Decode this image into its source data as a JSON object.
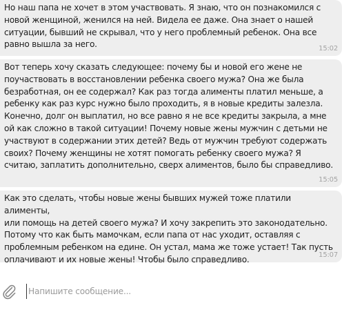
{
  "messages": [
    {
      "text": "Но наш папа не хочет в этом участвовать. Я знаю, что он познакомился с\nновой женщиной, женился на ней. Видела ее даже. Она знает о нашей\nситуации, бывший не скрывал, что у него проблемный ребенок. Она все\nравно вышла за него.",
      "time": "15:02"
    },
    {
      "text": "Вот теперь хочу сказать следующее: почему бы и новой его жене не\nпоучаствовать в восстановлении ребенка своего мужа? Она же была\nбезработная, он ее содержал? Как раз тогда алименты платил меньше, а\nребенку как раз курс нужно было проходить, я в новые кредиты залезла.\nКонечно, долг он выплатил, но все равно я не все кредиты закрыла, а мне\nой как сложно в такой ситуации! Почему новые жены мужчин с детьми не\nучаствуют в содержании этих детей? Ведь от мужчин требуют содержать\nсвоих? Почему женщины не хотят помогать ребенку своего мужа? Я\nсчитаю, заплатить дополнительно, сверх алиментов, было бы справедливо.",
      "time": "15:05"
    },
    {
      "text": "Как это сделать, чтобы новые жены бывших мужей тоже платили алименты,\nили помощь на детей своего мужа? И хочу закрепить это законодательно.\nПотому что как быть мамочкам, если папа от нас уходит, оставляя с\nпроблемным ребенком на едине. Он устал, мама же тоже устает! Так пусть\nоплачивают и их новые жены! Чтобы было справедливо.",
      "time": "15:07"
    }
  ],
  "composer": {
    "placeholder": "Напишите сообщение...",
    "value": "",
    "attach_icon": "paperclip-icon"
  },
  "colors": {
    "bubble_bg": "#eeeeee",
    "text": "#1e1e1e",
    "time": "#a3a3a3",
    "placeholder": "#9b9b9b",
    "icon": "#8a8a8a"
  }
}
